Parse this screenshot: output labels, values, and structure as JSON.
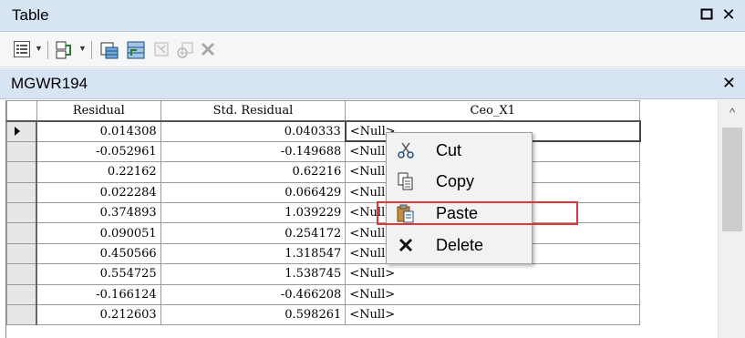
{
  "window": {
    "title": "Table"
  },
  "tab": {
    "name": "MGWR194"
  },
  "columns": [
    "Residual",
    "Std. Residual",
    "Ceo_X1"
  ],
  "rows": [
    {
      "residual": "0.014308",
      "std_residual": "0.040333",
      "ceo_x1": "<Null>"
    },
    {
      "residual": "-0.052961",
      "std_residual": "-0.149688",
      "ceo_x1": "<Null>"
    },
    {
      "residual": "0.22162",
      "std_residual": "0.62216",
      "ceo_x1": "<Null>"
    },
    {
      "residual": "0.022284",
      "std_residual": "0.066429",
      "ceo_x1": "<Null>"
    },
    {
      "residual": "0.374893",
      "std_residual": "1.039229",
      "ceo_x1": "<Null>"
    },
    {
      "residual": "0.090051",
      "std_residual": "0.254172",
      "ceo_x1": "<Null>"
    },
    {
      "residual": "0.450566",
      "std_residual": "1.318547",
      "ceo_x1": "<Null>"
    },
    {
      "residual": "0.554725",
      "std_residual": "1.538745",
      "ceo_x1": "<Null>"
    },
    {
      "residual": "-0.166124",
      "std_residual": "-0.466208",
      "ceo_x1": "<Null>"
    },
    {
      "residual": "0.212603",
      "std_residual": "0.598261",
      "ceo_x1": "<Null>"
    }
  ],
  "context_menu": {
    "items": [
      {
        "label": "Cut",
        "icon": "scissors-icon"
      },
      {
        "label": "Copy",
        "icon": "copy-icon"
      },
      {
        "label": "Paste",
        "icon": "paste-icon"
      },
      {
        "label": "Delete",
        "icon": "delete-icon"
      }
    ],
    "highlighted": "Paste",
    "highlight_color": "#e0353b"
  },
  "toolbar": {
    "icons": [
      "table-options-icon",
      "related-tables-icon",
      "select-by-attributes-icon",
      "switch-selection-icon",
      "clear-selection-icon",
      "zoom-to-selected-icon",
      "delete-selected-icon"
    ]
  }
}
